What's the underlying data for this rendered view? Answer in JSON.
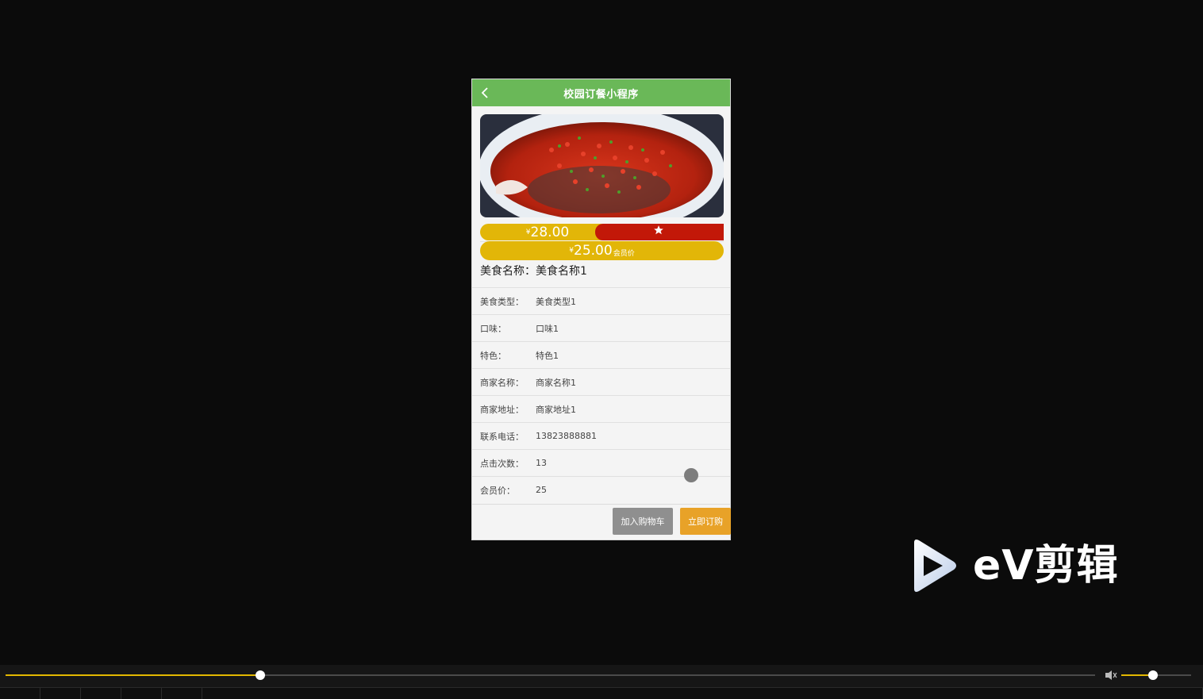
{
  "header": {
    "title": "校园订餐小程序"
  },
  "food": {
    "image_alt": "food-photo",
    "price_currency": "¥",
    "price": "28.00",
    "member_currency": "¥",
    "member_price": "25.00",
    "member_unit": "会员价",
    "name_label": "美食名称：",
    "name_value": "美食名称1"
  },
  "attributes": [
    {
      "label": "美食类型：",
      "value": "美食类型1"
    },
    {
      "label": "口味：",
      "value": "口味1"
    },
    {
      "label": "特色：",
      "value": "特色1"
    },
    {
      "label": "商家名称：",
      "value": "商家名称1"
    },
    {
      "label": "商家地址：",
      "value": "商家地址1"
    },
    {
      "label": "联系电话：",
      "value": "13823888881"
    },
    {
      "label": "点击次数：",
      "value": "13"
    },
    {
      "label": "会员价：",
      "value": "25"
    }
  ],
  "actions": {
    "add_cart": "加入购物车",
    "buy_now": "立即订购"
  },
  "watermark": {
    "text": "eV剪辑"
  },
  "player": {
    "progress": 0.234,
    "volume": 0.45
  },
  "colors": {
    "header": "#6ab858",
    "price_pill": "#e2b608",
    "favorite": "#c21808",
    "buy": "#e8a228",
    "cart": "#8f8f8f"
  }
}
